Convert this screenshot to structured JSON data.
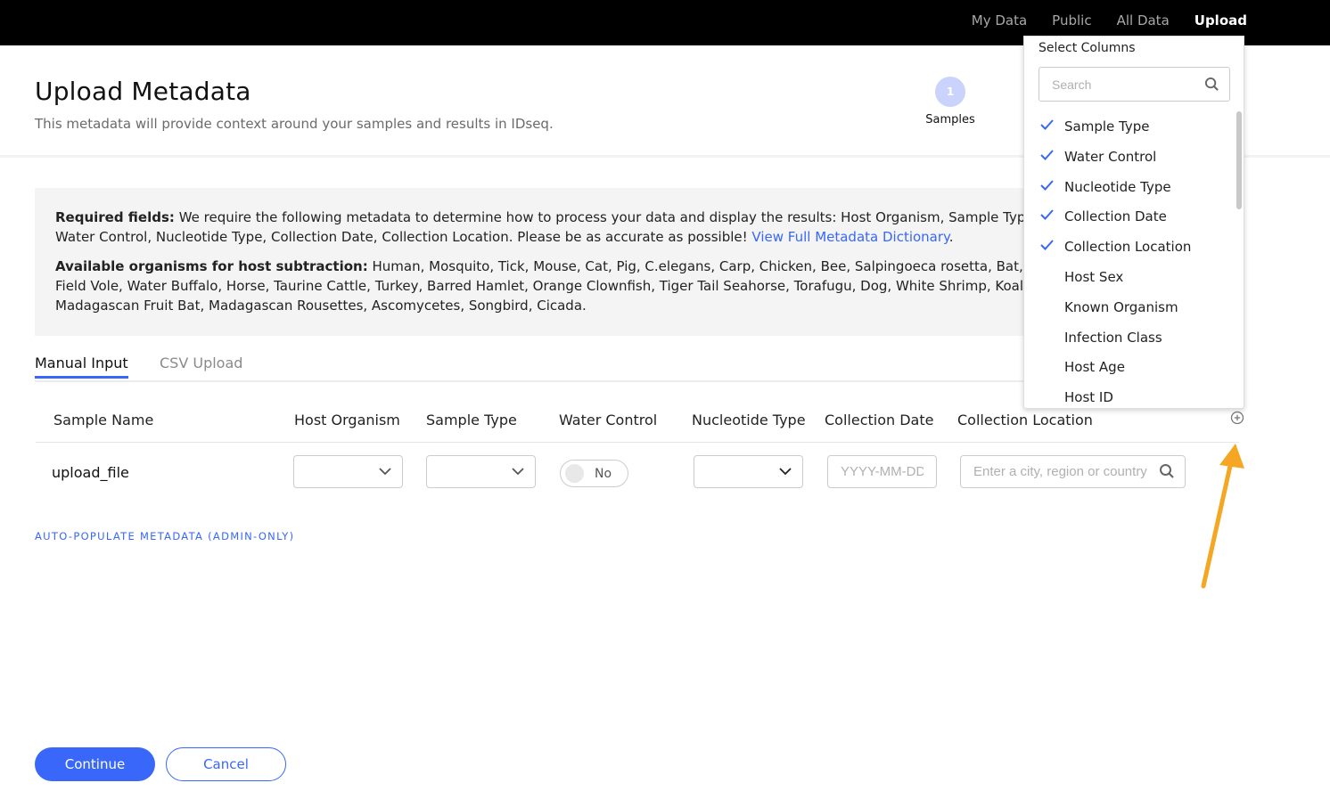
{
  "nav": {
    "items": [
      {
        "label": "My Data",
        "active": false
      },
      {
        "label": "Public",
        "active": false
      },
      {
        "label": "All Data",
        "active": false
      },
      {
        "label": "Upload",
        "active": true
      }
    ]
  },
  "header": {
    "title": "Upload Metadata",
    "subtitle": "This metadata will provide context around your samples and results in IDseq.",
    "step": {
      "number": "1",
      "label": "Samples"
    }
  },
  "info": {
    "required_label": "Required fields:",
    "required_text": " We require the following metadata to determine how to process your data and display the results: Host Organism, Sample Type, Water Control, Nucleotide Type, Collection Date, Collection Location. Please be as accurate as possible! ",
    "dictionary_link": "View Full Metadata Dictionary",
    "period": ".",
    "organisms_label": "Available organisms for host subtraction:",
    "organisms_text": " Human, Mosquito, Tick, Mouse, Cat, Pig, C.elegans, Carp, Chicken, Bee, Salpingoeca rosetta, Bat, Rat, Field Vole, Water Buffalo, Horse, Taurine Cattle, Turkey, Barred Hamlet, Orange Clownfish, Tiger Tail Seahorse, Torafugu, Dog, White Shrimp, Koala, Madagascan Fruit Bat, Madagascan Rousettes, Ascomycetes, Songbird, Cicada."
  },
  "tabs": {
    "manual": "Manual Input",
    "csv": "CSV Upload"
  },
  "table": {
    "headers": {
      "sample_name": "Sample Name",
      "host_organism": "Host Organism",
      "sample_type": "Sample Type",
      "water_control": "Water Control",
      "nucleotide_type": "Nucleotide Type",
      "collection_date": "Collection Date",
      "collection_location": "Collection Location"
    },
    "row": {
      "sample_name": "upload_file",
      "water_control": "No",
      "date_placeholder": "YYYY-MM-DD",
      "location_placeholder": "Enter a city, region or country"
    }
  },
  "autopopulate": "AUTO-POPULATE METADATA (ADMIN-ONLY)",
  "buttons": {
    "continue": "Continue",
    "cancel": "Cancel"
  },
  "column_selector": {
    "title": "Select Columns",
    "search_placeholder": "Search",
    "items": [
      {
        "label": "Sample Type",
        "checked": true
      },
      {
        "label": "Water Control",
        "checked": true
      },
      {
        "label": "Nucleotide Type",
        "checked": true
      },
      {
        "label": "Collection Date",
        "checked": true
      },
      {
        "label": "Collection Location",
        "checked": true
      },
      {
        "label": "Host Sex",
        "checked": false
      },
      {
        "label": "Known Organism",
        "checked": false
      },
      {
        "label": "Infection Class",
        "checked": false
      },
      {
        "label": "Host Age",
        "checked": false
      },
      {
        "label": "Host ID",
        "checked": false
      }
    ]
  },
  "colors": {
    "accent": "#3867fa",
    "annotation_arrow": "#f5a623",
    "nav_background": "#000000"
  }
}
